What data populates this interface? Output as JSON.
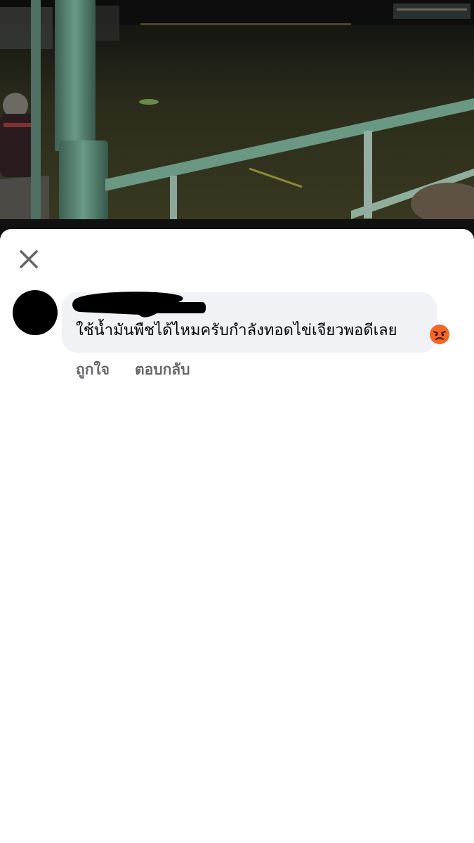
{
  "sheet": {
    "close_icon": "close-icon"
  },
  "comment": {
    "text": "ใช้น้ำมันพืชได้ไหมครับกำลังทอดไข่เจียวพอดีเลย",
    "reaction_emoji": "angry-face-emoji"
  },
  "actions": {
    "like_label": "ถูกใจ",
    "reply_label": "ตอบกลับ"
  },
  "colors": {
    "bubble_bg": "#f0f2f5",
    "action_text": "#65676b",
    "railing": "#5e8c78",
    "water": "#2e2f1c"
  }
}
